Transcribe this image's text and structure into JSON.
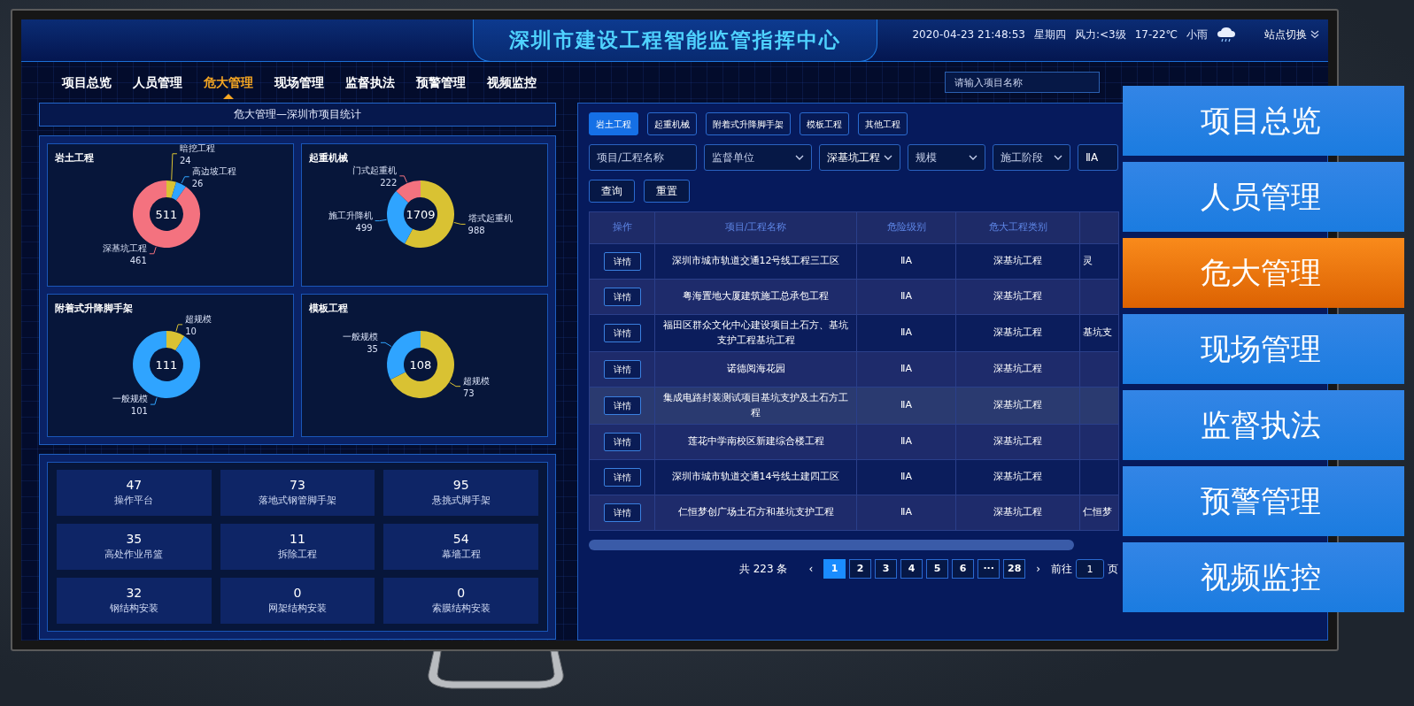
{
  "header": {
    "title": "深圳市建设工程智能监管指挥中心",
    "datetime": "2020-04-23 21:48:53",
    "weekday": "星期四",
    "wind": "风力:<3级",
    "temperature": "17-22℃",
    "weather": "小雨",
    "site_switch": "站点切换"
  },
  "nav": [
    {
      "label": "项目总览",
      "selected": false
    },
    {
      "label": "人员管理",
      "selected": false
    },
    {
      "label": "危大管理",
      "selected": true
    },
    {
      "label": "现场管理",
      "selected": false
    },
    {
      "label": "监督执法",
      "selected": false
    },
    {
      "label": "预警管理",
      "selected": false
    },
    {
      "label": "视频监控",
      "selected": false
    }
  ],
  "search": {
    "placeholder": "请输入项目名称"
  },
  "left_panel": {
    "title": "危大管理—深圳市项目统计",
    "charts": [
      {
        "total": "511",
        "chart_data": {
          "type": "donut",
          "title": "岩土工程",
          "categories": [
            "暗挖工程",
            "高边坡工程",
            "深基坑工程"
          ],
          "series": [
            {
              "values": [
                24,
                26,
                461
              ]
            }
          ],
          "colors": [
            "#d9c233",
            "#2fa4ff",
            "#f4727f"
          ],
          "data_labels": true
        }
      },
      {
        "total": "1709",
        "chart_data": {
          "type": "donut",
          "title": "起重机械",
          "categories": [
            "塔式起重机",
            "施工升降机",
            "门式起重机"
          ],
          "series": [
            {
              "values": [
                988,
                499,
                222
              ]
            }
          ],
          "colors": [
            "#d9c233",
            "#2fa4ff",
            "#f4727f"
          ],
          "data_labels": true
        }
      },
      {
        "total": "111",
        "chart_data": {
          "type": "donut",
          "title": "附着式升降脚手架",
          "categories": [
            "超规模",
            "一般规模"
          ],
          "series": [
            {
              "values": [
                10,
                101
              ]
            }
          ],
          "colors": [
            "#d9c233",
            "#2fa4ff"
          ],
          "data_labels": true
        }
      },
      {
        "total": "108",
        "chart_data": {
          "type": "donut",
          "title": "模板工程",
          "categories": [
            "超规模",
            "一般规模"
          ],
          "series": [
            {
              "values": [
                73,
                35
              ]
            }
          ],
          "colors": [
            "#d9c233",
            "#2fa4ff"
          ],
          "data_labels": true
        }
      }
    ],
    "stats": [
      {
        "value": "47",
        "label": "操作平台"
      },
      {
        "value": "73",
        "label": "落地式钢管脚手架"
      },
      {
        "value": "95",
        "label": "悬挑式脚手架"
      },
      {
        "value": "35",
        "label": "高处作业吊篮"
      },
      {
        "value": "11",
        "label": "拆除工程"
      },
      {
        "value": "54",
        "label": "幕墙工程"
      },
      {
        "value": "32",
        "label": "钢结构安装"
      },
      {
        "value": "0",
        "label": "网架结构安装"
      },
      {
        "value": "0",
        "label": "索膜结构安装"
      }
    ]
  },
  "right_panel": {
    "tabs": [
      {
        "label": "岩土工程",
        "selected": true
      },
      {
        "label": "起重机械",
        "selected": false
      },
      {
        "label": "附着式升降脚手架",
        "selected": false
      },
      {
        "label": "模板工程",
        "selected": false
      },
      {
        "label": "其他工程",
        "selected": false
      }
    ],
    "filters": [
      {
        "kind": "input",
        "placeholder": "项目/工程名称"
      },
      {
        "kind": "select",
        "placeholder": "监督单位"
      },
      {
        "kind": "select",
        "value": "深基坑工程"
      },
      {
        "kind": "select",
        "placeholder": "规模"
      },
      {
        "kind": "select",
        "placeholder": "施工阶段"
      },
      {
        "kind": "select",
        "value": "ⅡA"
      }
    ],
    "buttons": [
      "查询",
      "重置"
    ],
    "table": {
      "columns": [
        "操作",
        "项目/工程名称",
        "危险级别",
        "危大工程类别"
      ],
      "rows": [
        {
          "action": "详情",
          "name": "深圳市城市轨道交通12号线工程三工区",
          "level": "ⅡA",
          "category": "深基坑工程",
          "column_5": "灵",
          "highlighted": false
        },
        {
          "action": "详情",
          "name": "粤海置地大厦建筑施工总承包工程",
          "level": "ⅡA",
          "category": "深基坑工程",
          "highlighted": false
        },
        {
          "action": "详情",
          "name": "福田区群众文化中心建设项目土石方、基坑支护工程基坑工程",
          "level": "ⅡA",
          "category": "深基坑工程",
          "column_5": "基坑支",
          "highlighted": false
        },
        {
          "action": "详情",
          "name": "诺德阅海花园",
          "level": "ⅡA",
          "category": "深基坑工程",
          "highlighted": false
        },
        {
          "action": "详情",
          "name": "集成电路封装测试项目基坑支护及土石方工程",
          "level": "ⅡA",
          "category": "深基坑工程",
          "highlighted": true
        },
        {
          "action": "详情",
          "name": "莲花中学南校区新建综合楼工程",
          "level": "ⅡA",
          "category": "深基坑工程",
          "highlighted": false
        },
        {
          "action": "详情",
          "name": "深圳市城市轨道交通14号线土建四工区",
          "level": "ⅡA",
          "category": "深基坑工程",
          "highlighted": false
        },
        {
          "action": "详情",
          "name": "仁恒梦创广场土石方和基坑支护工程",
          "level": "ⅡA",
          "category": "深基坑工程",
          "column_5": "仁恒梦",
          "highlighted": false
        }
      ]
    },
    "pagination": {
      "total": "共 223 条",
      "prev": "‹",
      "next": "›",
      "pages": [
        {
          "label": "1",
          "selected": true
        },
        {
          "label": "2",
          "selected": false
        },
        {
          "label": "3",
          "selected": false
        },
        {
          "label": "4",
          "selected": false
        },
        {
          "label": "5",
          "selected": false
        },
        {
          "label": "6",
          "selected": false
        },
        {
          "label": "···",
          "selected": false
        },
        {
          "label": "28",
          "selected": false
        }
      ],
      "goto_label": "前往",
      "goto_value": "1",
      "goto_suffix": "页"
    }
  },
  "side_menu": [
    {
      "label": "项目总览",
      "selected": false
    },
    {
      "label": "人员管理",
      "selected": false
    },
    {
      "label": "危大管理",
      "selected": true
    },
    {
      "label": "现场管理",
      "selected": false
    },
    {
      "label": "监督执法",
      "selected": false
    },
    {
      "label": "预警管理",
      "selected": false
    },
    {
      "label": "视频监控",
      "selected": false
    }
  ]
}
